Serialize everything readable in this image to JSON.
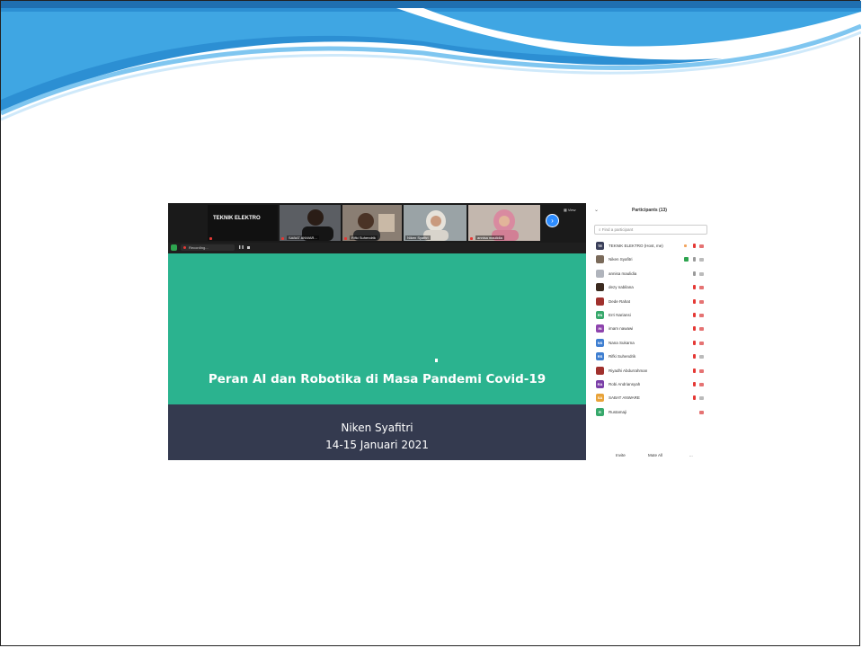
{
  "meeting": {
    "host_tile_label": "TEKNIK ELEKTRO",
    "view_label": "View",
    "recording_label": "Recording...",
    "gallery_tiles": [
      {
        "name": "SABAT ANWAR...",
        "muted": true
      },
      {
        "name": "Rifki Suhendrik",
        "muted": true
      },
      {
        "name": "Niken Syafitri",
        "muted": false
      },
      {
        "name": "annisa maulidia",
        "muted": true
      }
    ]
  },
  "shared_slide": {
    "title": "Peran AI dan Robotika di Masa Pandemi Covid-19",
    "author": "Niken Syafitri",
    "date": "14-15 Januari 2021",
    "colors": {
      "top": "#2bb38f",
      "bottom": "#343a4f"
    }
  },
  "participants_panel": {
    "title": "Participants (13)",
    "search_placeholder": "Find a participant",
    "participants": [
      {
        "initials": "TE",
        "name": "TEKNIK ELEKTRO (Host, me)",
        "avatar_color": "#3a3f5a",
        "hand": true,
        "mic": "off",
        "cam": "off"
      },
      {
        "initials": "",
        "name": "Niken Syafitri",
        "avatar_color": "#7a6a5a",
        "share": true,
        "mic": "on",
        "cam": "on"
      },
      {
        "initials": "",
        "name": "annisa maulidia",
        "avatar_color": "#b0b4bc",
        "mic": "on",
        "cam": "on"
      },
      {
        "initials": "",
        "name": "dezy nabilana",
        "avatar_color": "#3b2a1f",
        "mic": "off",
        "cam": "off"
      },
      {
        "initials": "",
        "name": "Dede Rahat",
        "avatar_color": "#a0312d",
        "mic": "off",
        "cam": "off"
      },
      {
        "initials": "EN",
        "name": "Erri Nariansi",
        "avatar_color": "#37a86b",
        "mic": "off",
        "cam": "off"
      },
      {
        "initials": "IN",
        "name": "imam nawawi",
        "avatar_color": "#8e44ad",
        "mic": "off",
        "cam": "off"
      },
      {
        "initials": "NS",
        "name": "Nana Sukarna",
        "avatar_color": "#3f7fd1",
        "mic": "off",
        "cam": "off"
      },
      {
        "initials": "RS",
        "name": "Rifki Suhendrik",
        "avatar_color": "#3f7fd1",
        "mic": "off",
        "cam": "on"
      },
      {
        "initials": "",
        "name": "Riyadhi Abdurrahman",
        "avatar_color": "#a0312d",
        "mic": "off",
        "cam": "off"
      },
      {
        "initials": "RA",
        "name": "Robi Andriansyah",
        "avatar_color": "#7b3fa8",
        "mic": "off",
        "cam": "off"
      },
      {
        "initials": "SA",
        "name": "SABAT ANWARE",
        "avatar_color": "#e8a33a",
        "mic": "off",
        "cam": "on"
      },
      {
        "initials": "R",
        "name": "Rustamaji",
        "avatar_color": "#37a86b",
        "mic": "",
        "cam": "off"
      }
    ],
    "footer": {
      "invite": "Invite",
      "mute_all": "Mute All",
      "more": "..."
    }
  }
}
